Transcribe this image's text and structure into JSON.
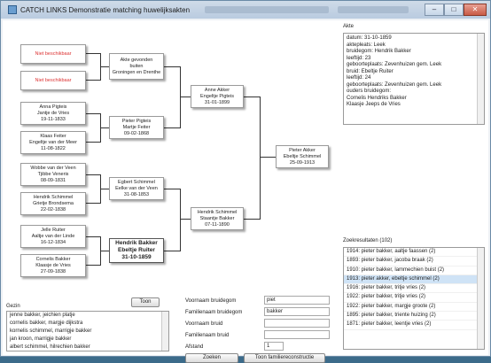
{
  "window": {
    "title": "CATCH LINKS Demonstratie matching huwelijksakten"
  },
  "pedigree": {
    "gen0": [
      {
        "lines": [
          "Niet beschikbaar"
        ],
        "missing": true
      },
      {
        "lines": [
          "Niet beschikbaar"
        ],
        "missing": true
      },
      {
        "lines": [
          "Anna Pigteis",
          "Jantje de Vries",
          "19-11-1833"
        ]
      },
      {
        "lines": [
          "Klaas Feiter",
          "Engeltje van der Meer",
          "11-08-1822"
        ]
      },
      {
        "lines": [
          "Wobbe van der Veen",
          "Tjibbe Veneris",
          "08-09-1831"
        ]
      },
      {
        "lines": [
          "Hendrik Schimmel",
          "Grietje Brondsema",
          "22-02-1838"
        ]
      },
      {
        "lines": [
          "Jelle Ruiter",
          "Aaltje van der Linde",
          "16-12-1834"
        ]
      },
      {
        "lines": [
          "Cornelis Bakker",
          "Klaasje de Vries",
          "27-09-1838"
        ]
      }
    ],
    "gen1": [
      {
        "lines": [
          "Akte gevonden",
          "buiten",
          "Groningen en Drenthe"
        ]
      },
      {
        "lines": [
          "Pieter Pigteis",
          "Martje Feiter",
          "09-02-1868"
        ]
      },
      {
        "lines": [
          "Egbert Schimmel",
          "Eelke van der Veen",
          "31-08-1853"
        ]
      },
      {
        "lines": [
          "Hendrik Bakker",
          "Ebeltje Ruiter",
          "31-10-1859"
        ],
        "bold": true
      }
    ],
    "gen2": [
      {
        "lines": [
          "Anne Akker",
          "Engeltje Pigteis",
          "31-01-1899"
        ]
      },
      {
        "lines": [
          "Hendrik Schimmel",
          "Staantje Bakker",
          "07-11-1890"
        ]
      }
    ],
    "gen3": [
      {
        "lines": [
          "Pieter Akker",
          "Ebeltje Schimmel",
          "25-09-1913"
        ]
      }
    ]
  },
  "akte": {
    "label": "Akte",
    "lines": [
      "datum: 31-10-1859",
      "aktepleats: Leek",
      "bruidegom: Hendrik Bakker",
      "leeftijd: 23",
      "geboorteplaats: Zevenhuizen gem. Leek",
      "bruid: Ebeltje Ruiter",
      "leeftijd: 24",
      "geboorteplaats: Zevenhuizen gem. Leek",
      "ouders bruidegom:",
      "Cornelis Hendriks Bakker",
      "Klaasje Jeeps de Vries"
    ]
  },
  "gezin": {
    "label": "Gezin",
    "toon_button": "Toon",
    "items": [
      "jenne bakker, jeichien platje",
      "cornelis bakker, margje dijkstra",
      "kornelis schimmel, marrigje bakker",
      "jan kroon, marrigje bakker",
      "albert schimmel, hilrechien bakker"
    ]
  },
  "form": {
    "fields": [
      {
        "label": "Voornaam bruidegom",
        "value": "piet"
      },
      {
        "label": "Familienaam bruidegom",
        "value": "bakker"
      },
      {
        "label": "Voornaam bruid",
        "value": ""
      },
      {
        "label": "Familienaam bruid",
        "value": ""
      }
    ],
    "afstand_label": "Afstand",
    "afstand_value": "1",
    "zoeken_button": "Zoeken",
    "toon_familie_button": "Toon familiereconstructie"
  },
  "results": {
    "label": "Zoekresultaten (102)",
    "items": [
      "1914: pieter bakker, aaltje faassen (2)",
      "1893: pieter bakker, jacoba braak (2)",
      "1910: pieter bakker, lammechien buist (2)",
      "1913: pieter akker, ebeltje schimmel (2)",
      "1916: pieter bakker, tritje vries (2)",
      "1922: pieter bakker, tritje vries (2)",
      "1922: pieter bakker, margje groote (2)",
      "1895: pieter bakker, triente huizing (2)",
      "1871: pieter bakker, leentje vries (2)"
    ],
    "selected_index": 3
  }
}
